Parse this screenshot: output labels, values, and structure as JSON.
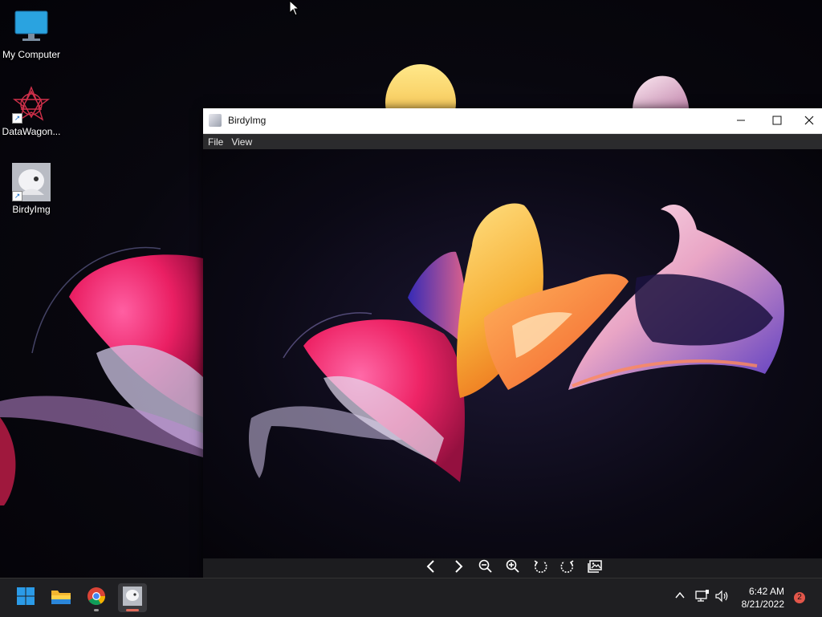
{
  "desktop": {
    "icons": [
      {
        "label": "My Computer",
        "icon": "monitor-icon"
      },
      {
        "label": "DataWagon...",
        "icon": "datawagon-icon"
      },
      {
        "label": "BirdyImg",
        "icon": "birdyimg-icon"
      }
    ]
  },
  "window": {
    "title": "BirdyImg",
    "menu": [
      "File",
      "View"
    ],
    "controls": {
      "minimize": "minimize-icon",
      "maximize": "maximize-icon",
      "close": "close-icon"
    }
  },
  "toolbar": {
    "buttons": [
      "previous-icon",
      "next-icon",
      "zoom-out-icon",
      "zoom-in-icon",
      "rotate-left-icon",
      "rotate-right-icon",
      "gallery-icon"
    ]
  },
  "taskbar": {
    "apps": [
      "windows-start-icon",
      "file-explorer-icon",
      "chrome-icon",
      "birdyimg-icon"
    ],
    "tray": [
      "chevron-up-icon",
      "network-icon",
      "volume-icon"
    ],
    "clock": {
      "time": "6:42 AM",
      "date": "8/21/2022"
    },
    "notifications": "2"
  },
  "colors": {
    "accent": "#0078d4",
    "taskbar": "#1f1f22",
    "active_underline": "#e06a5a"
  }
}
